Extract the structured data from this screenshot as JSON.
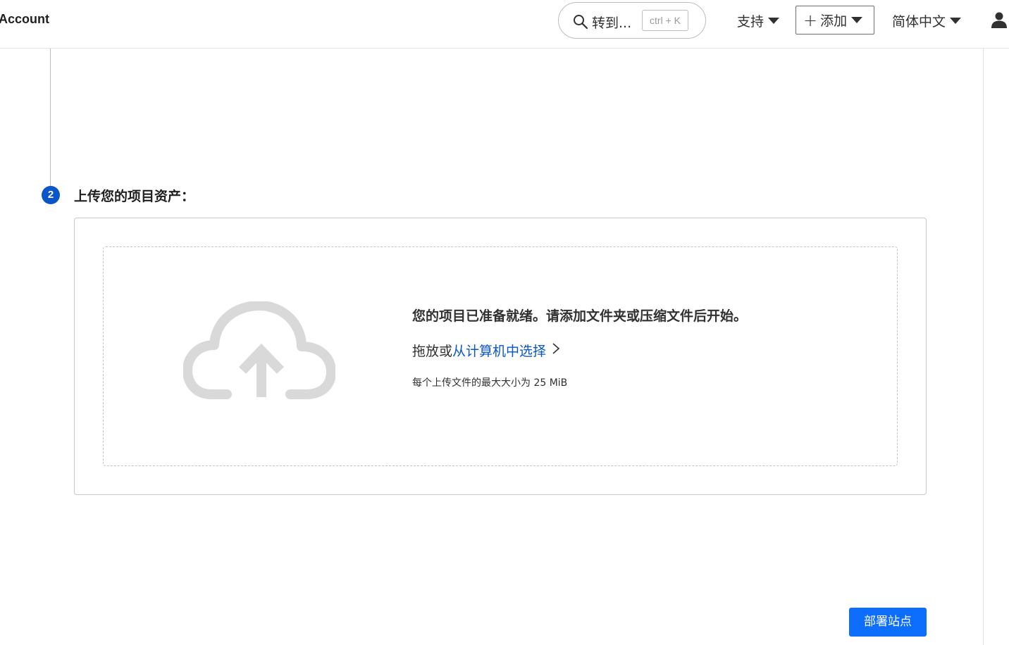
{
  "header": {
    "account_title": "Account",
    "search": {
      "label": "转到...",
      "shortcut": "ctrl + K",
      "icon": "search-icon"
    },
    "support_label": "支持",
    "add_label": "添加",
    "language_label": "简体中文",
    "user_icon": "user-icon"
  },
  "step": {
    "number": "2",
    "title": "上传您的项目资产："
  },
  "upload": {
    "icon": "cloud-upload-icon",
    "heading": "您的项目已准备就绪。请添加文件夹或压缩文件后开始。",
    "action_prefix": "拖放或",
    "action_link": "从计算机中选择",
    "note": "每个上传文件的最大大小为 25 MiB"
  },
  "footer": {
    "deploy_label": "部署站点"
  },
  "colors": {
    "accent_blue": "#0a56c8",
    "deploy_button": "#0d6efd",
    "cloud_icon": "#d9d9d9"
  }
}
